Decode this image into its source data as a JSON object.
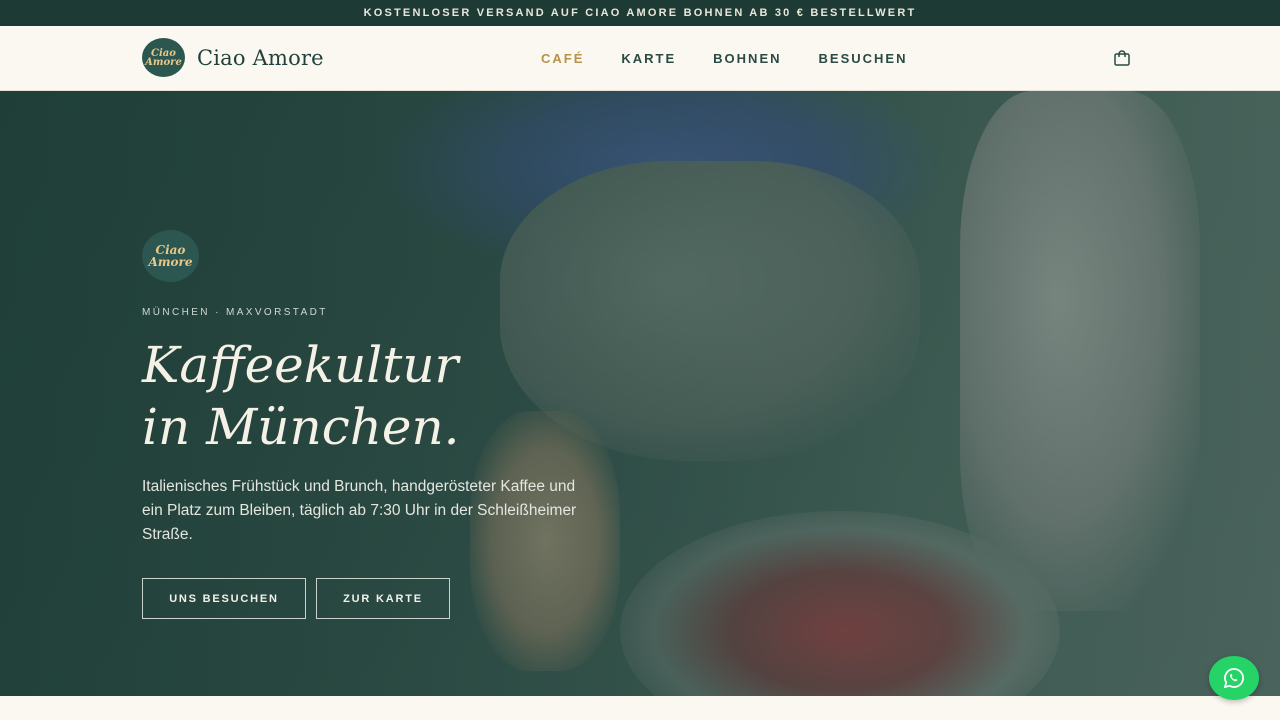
{
  "announcement": "KOSTENLOSER VERSAND AUF CIAO AMORE BOHNEN AB 30 € BESTELLWERT",
  "header": {
    "brand_name": "Ciao Amore",
    "logo_line1": "Ciao",
    "logo_line2": "Amore",
    "nav": [
      {
        "label": "CAFÉ",
        "active": true
      },
      {
        "label": "KARTE",
        "active": false
      },
      {
        "label": "BOHNEN",
        "active": false
      },
      {
        "label": "BESUCHEN",
        "active": false
      }
    ],
    "cart_icon": "shopping-bag-icon"
  },
  "hero": {
    "logo_line1": "Ciao",
    "logo_line2": "Amore",
    "eyebrow": "MÜNCHEN · MAXVORSTADT",
    "headline_line1": "Kaffeekultur",
    "headline_line2": "in München.",
    "subtext": "Italienisches Frühstück und Brunch, handgerösteter Kaffee und ein Platz zum Bleiben, täglich ab 7:30 Uhr in der Schleißheimer Straße.",
    "btn_visit": "UNS BESUCHEN",
    "btn_menu": "ZUR KARTE"
  },
  "colors": {
    "announce_bg": "#1e3a35",
    "accent_gold": "#b8914b",
    "whatsapp": "#25d366"
  },
  "whatsapp_icon": "whatsapp-icon"
}
